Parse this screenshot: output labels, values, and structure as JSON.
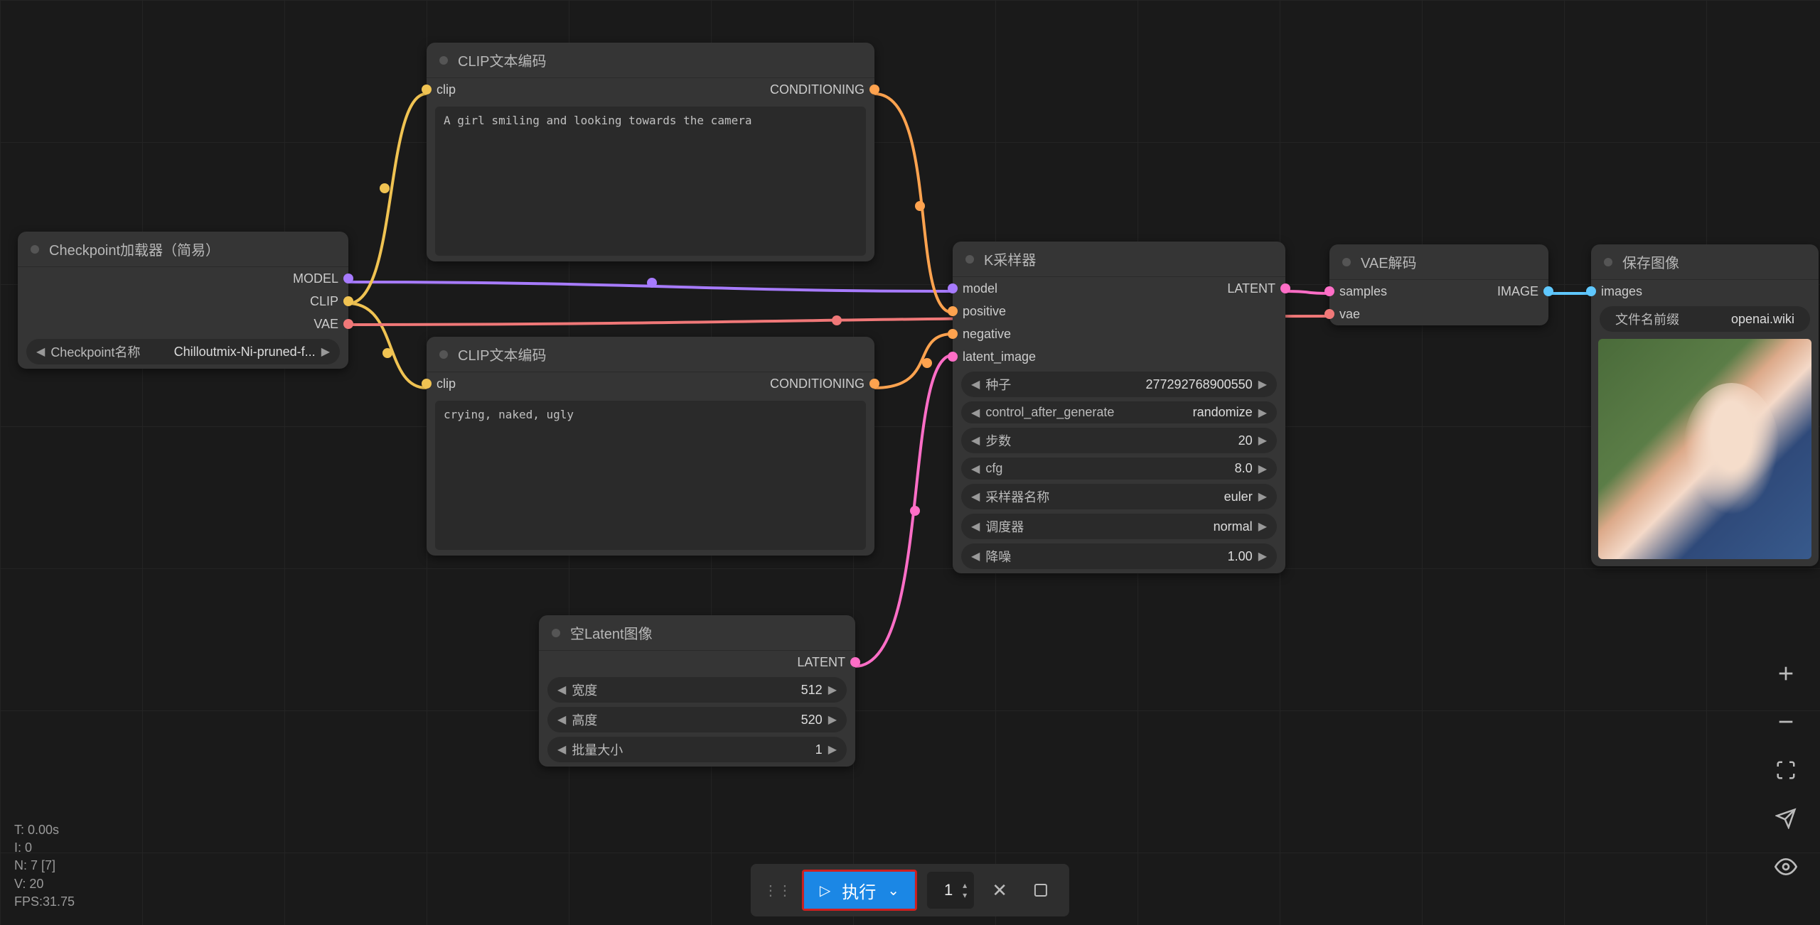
{
  "watermark": "OPENAI.WIKI",
  "nodes": {
    "checkpoint": {
      "title": "Checkpoint加载器（简易）",
      "outputs": {
        "model": "MODEL",
        "clip": "CLIP",
        "vae": "VAE"
      },
      "widget": {
        "label": "Checkpoint名称",
        "value": "Chilloutmix-Ni-pruned-f..."
      }
    },
    "clip_pos": {
      "title": "CLIP文本编码",
      "inputs": {
        "clip": "clip"
      },
      "outputs": {
        "cond": "CONDITIONING"
      },
      "text": "A girl smiling and looking towards the camera"
    },
    "clip_neg": {
      "title": "CLIP文本编码",
      "inputs": {
        "clip": "clip"
      },
      "outputs": {
        "cond": "CONDITIONING"
      },
      "text": "crying, naked, ugly"
    },
    "latent": {
      "title": "空Latent图像",
      "outputs": {
        "latent": "LATENT"
      },
      "widgets": {
        "width": {
          "label": "宽度",
          "value": "512"
        },
        "height": {
          "label": "高度",
          "value": "520"
        },
        "batch": {
          "label": "批量大小",
          "value": "1"
        }
      }
    },
    "ksampler": {
      "title": "K采样器",
      "inputs": {
        "model": "model",
        "positive": "positive",
        "negative": "negative",
        "latent_image": "latent_image"
      },
      "outputs": {
        "latent": "LATENT"
      },
      "widgets": {
        "seed": {
          "label": "种子",
          "value": "277292768900550"
        },
        "control": {
          "label": "control_after_generate",
          "value": "randomize"
        },
        "steps": {
          "label": "步数",
          "value": "20"
        },
        "cfg": {
          "label": "cfg",
          "value": "8.0"
        },
        "sampler": {
          "label": "采样器名称",
          "value": "euler"
        },
        "scheduler": {
          "label": "调度器",
          "value": "normal"
        },
        "denoise": {
          "label": "降噪",
          "value": "1.00"
        }
      }
    },
    "vae_decode": {
      "title": "VAE解码",
      "inputs": {
        "samples": "samples",
        "vae": "vae"
      },
      "outputs": {
        "image": "IMAGE"
      }
    },
    "save": {
      "title": "保存图像",
      "inputs": {
        "images": "images"
      },
      "widget": {
        "label": "文件名前缀",
        "value": "openai.wiki"
      }
    }
  },
  "stats": {
    "t": "T: 0.00s",
    "i": "I: 0",
    "n": "N: 7 [7]",
    "v": "V: 20",
    "fps": "FPS:31.75"
  },
  "toolbar": {
    "run": "执行",
    "count": "1"
  }
}
